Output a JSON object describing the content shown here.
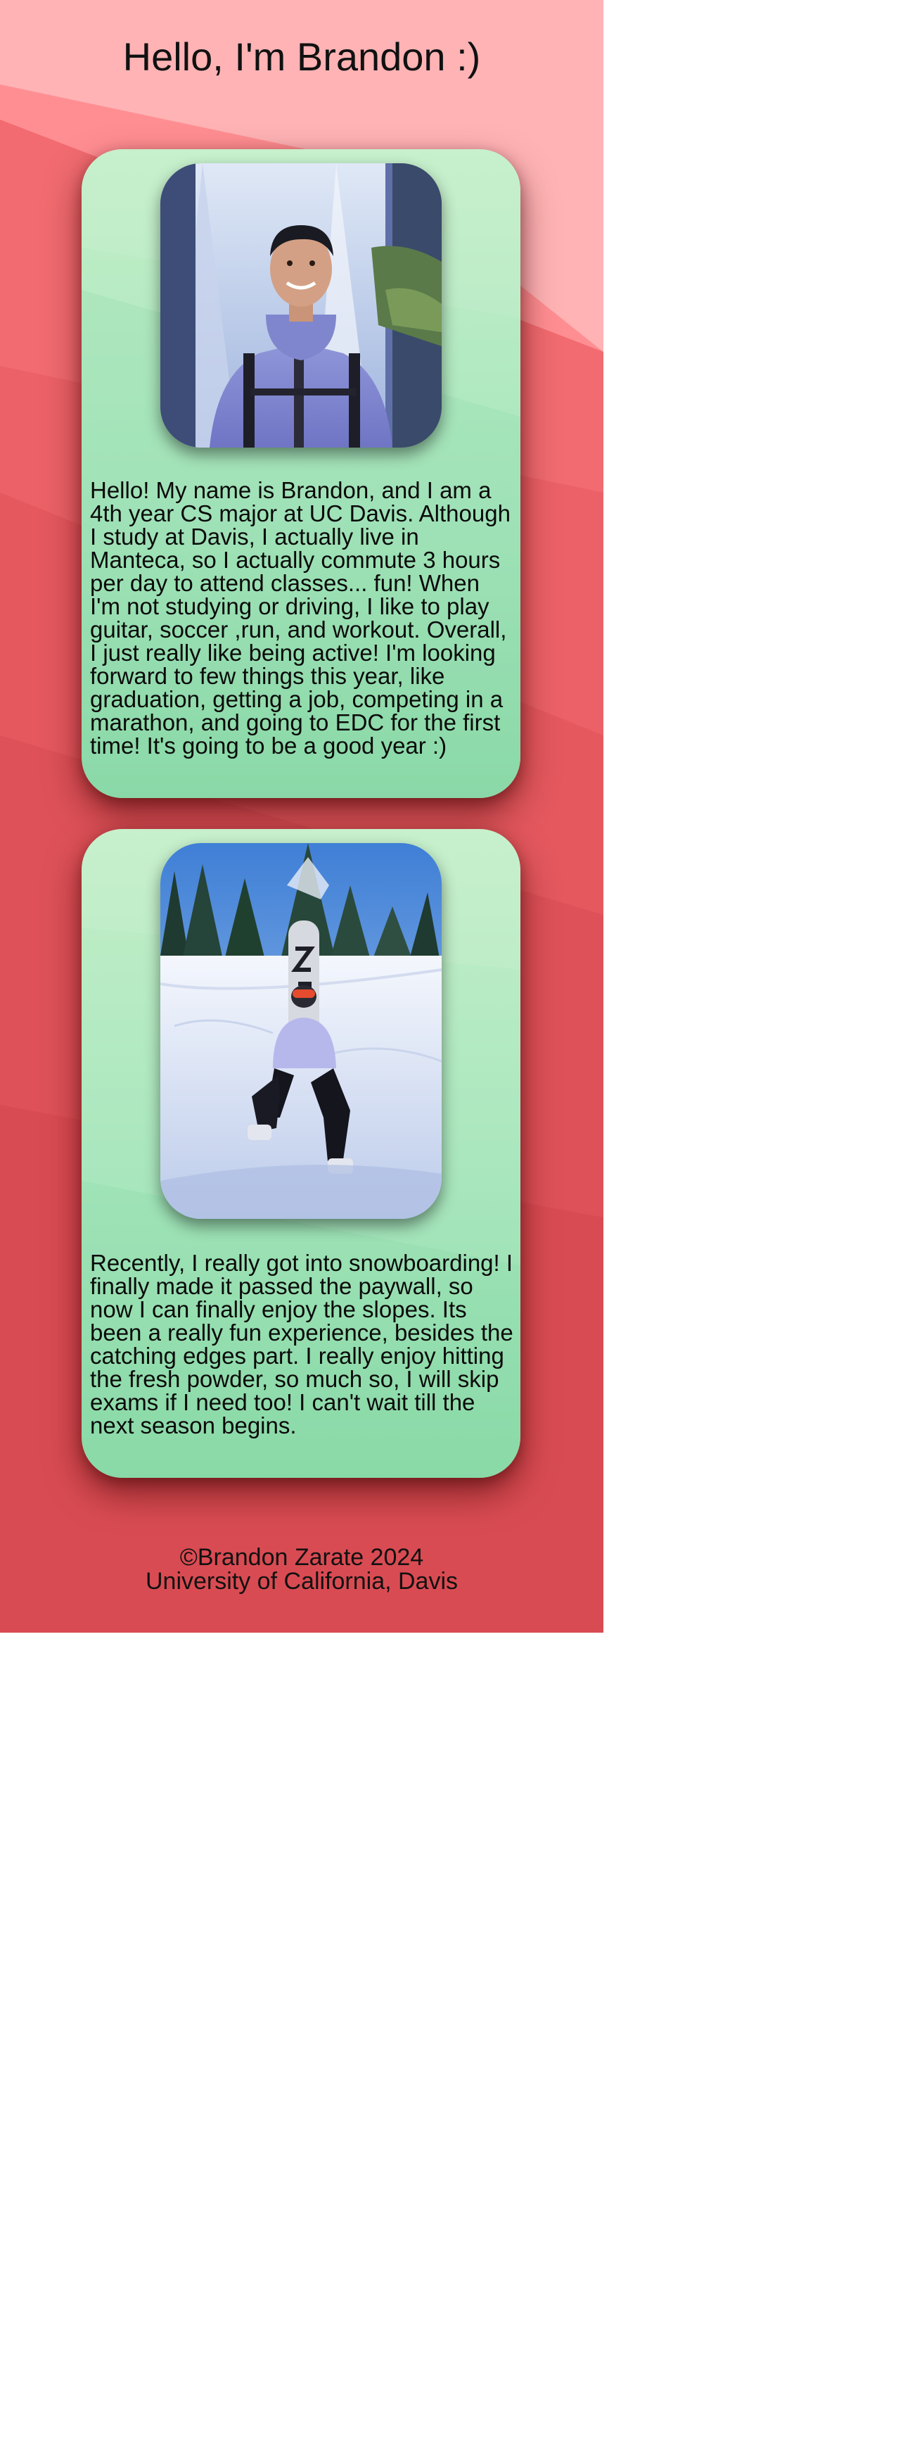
{
  "header": {
    "title": "Hello, I'm Brandon :)"
  },
  "cards": [
    {
      "photo_alt": "Brandon standing in front of a waterfall",
      "text": "Hello! My name is Brandon, and I am a 4th year CS major at UC Davis. Although I study at Davis, I actually live in Manteca, so I actually commute 3 hours per day to attend classes... fun! When I'm not studying or driving, I like to play guitar, soccer ,run, and workout. Overall, I just really like being active! I'm looking forward to few things this year, like graduation, getting a job, competing in a marathon, and going to EDC for the first time! It's going to be a good year :)"
    },
    {
      "photo_alt": "Brandon sitting in snow with a snowboard",
      "text": "Recently, I really got into snowboarding! I finally made it passed the paywall, so now I can finally enjoy the slopes. Its been a really fun experience, besides the catching edges part. I really enjoy hitting the fresh powder, so much so, I will skip exams if I need too! I can't wait till the next season begins."
    }
  ],
  "footer": {
    "copyright": "©Brandon Zarate 2024",
    "school": "University of California, Davis"
  },
  "colors": {
    "background_top": "#ffb3b5",
    "background_bottom": "#d94b52",
    "card_top": "#c3efc8",
    "card_bottom": "#8ddaa9"
  }
}
